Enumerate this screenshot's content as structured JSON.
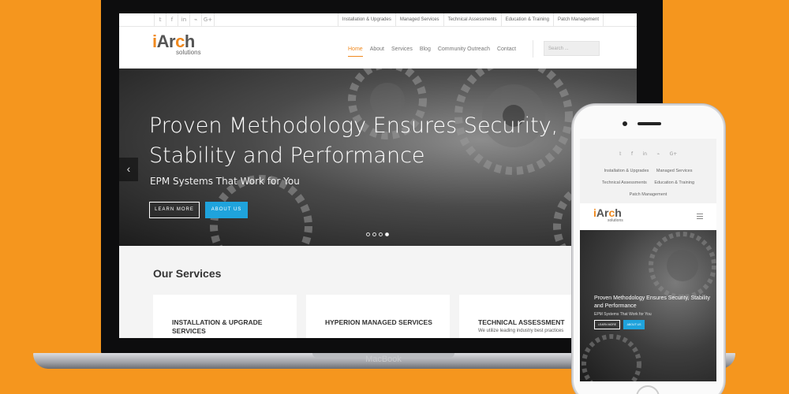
{
  "laptop": {
    "brand": "MacBook"
  },
  "site": {
    "social_icons": [
      {
        "name": "twitter-icon",
        "glyph": "𝕥"
      },
      {
        "name": "facebook-icon",
        "glyph": "f"
      },
      {
        "name": "linkedin-icon",
        "glyph": "in"
      },
      {
        "name": "rss-icon",
        "glyph": "⌁"
      },
      {
        "name": "google-plus-icon",
        "glyph": "G+"
      }
    ],
    "top_links": [
      "Installation & Upgrades",
      "Managed Services",
      "Technical Assessments",
      "Education & Training",
      "Patch Management"
    ],
    "logo": {
      "main_i": "i",
      "main_ar": "Ar",
      "main_c": "c",
      "main_h": "h",
      "sub": "solutions"
    },
    "nav": [
      "Home",
      "About",
      "Services",
      "Blog",
      "Community Outreach",
      "Contact"
    ],
    "search_placeholder": "Search ...",
    "hero": {
      "title": "Proven Methodology Ensures Security, Stability and Performance",
      "subtitle": "EPM Systems That Work for You",
      "learn_more": "LEARN MORE",
      "about_us": "ABOUT US",
      "prev_glyph": "‹",
      "slide_count": 4,
      "active_slide": 4
    },
    "services": {
      "title": "Our Services",
      "cards": [
        {
          "title": "INSTALLATION & UPGRADE SERVICES",
          "desc": ""
        },
        {
          "title": "HYPERION MANAGED SERVICES",
          "desc": ""
        },
        {
          "title": "TECHNICAL ASSESSMENT",
          "desc": "We utilize leading industry best practices"
        }
      ]
    }
  },
  "mobile": {
    "social": [
      "𝕥",
      "f",
      "in",
      "⌁",
      "G+"
    ],
    "links": [
      "Installation & Upgrades",
      "Managed Services",
      "Technical Assessments",
      "Education & Training",
      "Patch Management"
    ],
    "hero": {
      "title": "Proven Methodology Ensures Security, Stability and Performance",
      "subtitle": "EPM Systems That Work for You",
      "learn_more": "LEARN MORE",
      "about_us": "ABOUT US"
    }
  },
  "colors": {
    "background": "#f5961e",
    "accent": "#f0891e",
    "button_blue": "#1fa3dc"
  }
}
